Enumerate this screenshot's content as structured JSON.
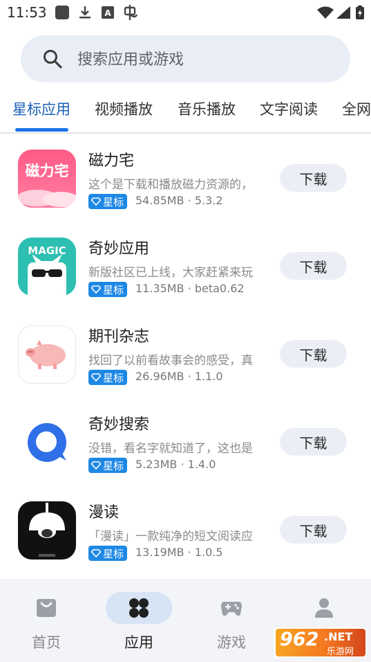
{
  "status_bar": {
    "time": "11:53",
    "icons": [
      "app-square-icon",
      "download-icon",
      "a-badge-icon",
      "bug-icon",
      "wifi-icon",
      "signal-icon",
      "battery-icon"
    ]
  },
  "search": {
    "placeholder": "搜索应用或游戏"
  },
  "tabs": [
    "星标应用",
    "视频播放",
    "音乐播放",
    "文字阅读",
    "全网"
  ],
  "active_tab": 0,
  "apps": [
    {
      "name": "磁力宅",
      "icon_text": "磁力宅",
      "description": "这个是下载和播放磁力资源的，",
      "badge": "星标",
      "meta": "54.85MB · 5.3.2",
      "button": "下载"
    },
    {
      "name": "奇妙应用",
      "icon_text": "MAGIC",
      "description": "新版社区已上线，大家赶紧来玩",
      "badge": "星标",
      "meta": "11.35MB · beta0.62",
      "button": "下载"
    },
    {
      "name": "期刊杂志",
      "description": "找回了以前看故事会的感受，真",
      "badge": "星标",
      "meta": "26.96MB · 1.1.0",
      "button": "下载"
    },
    {
      "name": "奇妙搜索",
      "description": "没错，看名字就知道了，这也是",
      "badge": "星标",
      "meta": "5.23MB · 1.4.0",
      "button": "下载"
    },
    {
      "name": "漫读",
      "description": "「漫读」一款纯净的短文阅读应",
      "badge": "星标",
      "meta": "13.19MB · 1.0.5",
      "button": "下载"
    }
  ],
  "bottom_nav": [
    {
      "label": "首页",
      "icon": "inbox-icon"
    },
    {
      "label": "应用",
      "icon": "apps-grid-icon"
    },
    {
      "label": "游戏",
      "icon": "gamepad-icon"
    },
    {
      "label": "",
      "icon": "person-icon"
    }
  ],
  "active_nav": 1,
  "watermark": {
    "number": "962",
    "net": ".NET",
    "sub": "乐游网"
  },
  "colors": {
    "accent": "#1a73e8",
    "badge": "#1e88e5",
    "search_bg": "#e9eef6",
    "button_bg": "#ebeff5",
    "nav_bg": "#f2f4f7",
    "active_pill": "#d6e4f5"
  }
}
